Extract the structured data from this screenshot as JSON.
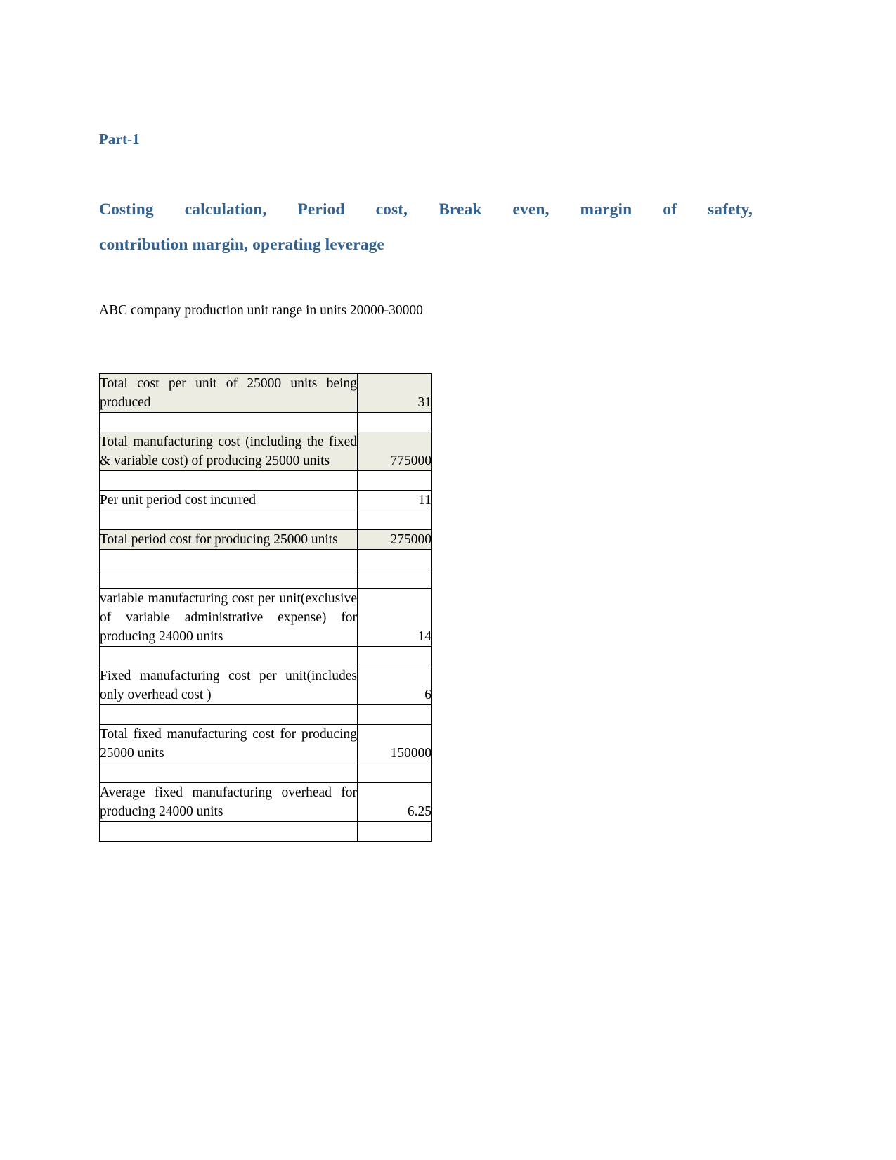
{
  "document": {
    "part_heading": "Part-1",
    "topic_heading_line1": "Costing calculation, Period cost, Break even, margin of safety,",
    "topic_heading_line2": "contribution margin, operating leverage",
    "intro_text": "ABC company production unit range in units 20000-30000",
    "colors": {
      "heading_blue": "#35618E",
      "body_black": "#000000",
      "table_row_tint": "#EDECE2",
      "table_border": "#000000",
      "page_background": "#FFFFFF"
    }
  },
  "table": {
    "rows": [
      {
        "type": "data",
        "tint": true,
        "label": "Total cost per unit of 25000 units being produced",
        "value": "31"
      },
      {
        "type": "gap",
        "tint": false,
        "label": "",
        "value": ""
      },
      {
        "type": "data",
        "tint": true,
        "label": "Total manufacturing cost (including the fixed & variable cost) of producing 25000 units",
        "value": "775000"
      },
      {
        "type": "gap",
        "tint": false,
        "label": "",
        "value": ""
      },
      {
        "type": "data",
        "tint": false,
        "label": "Per unit period cost incurred",
        "value": "11"
      },
      {
        "type": "gap",
        "tint": false,
        "label": "",
        "value": ""
      },
      {
        "type": "data",
        "tint": true,
        "label": "Total period cost for producing 25000 units",
        "value": "275000"
      },
      {
        "type": "gap",
        "tint": false,
        "label": "",
        "value": ""
      },
      {
        "type": "gap",
        "tint": false,
        "label": "",
        "value": ""
      },
      {
        "type": "data",
        "tint": false,
        "label": "variable manufacturing cost per unit(exclusive of variable administrative expense) for producing 24000 units",
        "value": "14"
      },
      {
        "type": "gap",
        "tint": false,
        "label": "",
        "value": ""
      },
      {
        "type": "data",
        "tint": false,
        "label": "Fixed manufacturing cost per unit(includes only overhead cost )",
        "value": "6"
      },
      {
        "type": "gap",
        "tint": false,
        "label": "",
        "value": ""
      },
      {
        "type": "data",
        "tint": false,
        "label": "Total fixed manufacturing cost for producing 25000 units",
        "value": "150000"
      },
      {
        "type": "gap",
        "tint": false,
        "label": "",
        "value": ""
      },
      {
        "type": "data",
        "tint": false,
        "label": "Average fixed manufacturing overhead for producing 24000 units",
        "value": "6.25"
      },
      {
        "type": "gap",
        "tint": false,
        "label": "",
        "value": ""
      }
    ]
  }
}
